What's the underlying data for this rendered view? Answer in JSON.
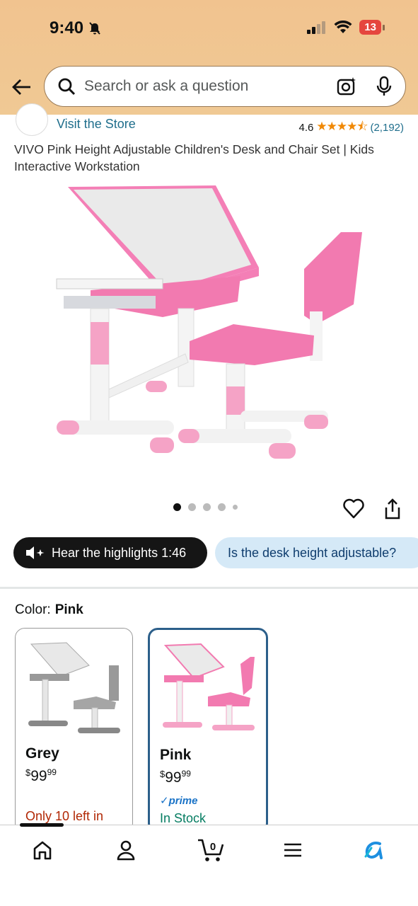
{
  "status_bar": {
    "time": "9:40",
    "battery": "13"
  },
  "search": {
    "placeholder": "Search or ask a question"
  },
  "store": {
    "visit_label": "Visit the Store",
    "rating": "4.6",
    "stars": "★★★★⯪",
    "rating_count": "(2,192)"
  },
  "product": {
    "title": "VIVO Pink Height Adjustable Children's Desk and Chair Set | Kids Interactive Workstation"
  },
  "gallery": {
    "active_index": 0,
    "dot_count": 5
  },
  "actions": {
    "hear_label": "Hear the highlights 1:46",
    "question_chip": "Is the desk height adjustable?"
  },
  "color": {
    "label": "Color:",
    "selected": "Pink",
    "options": [
      {
        "name": "Grey",
        "currency": "$",
        "price_whole": "99",
        "price_fraction": "99",
        "availability": "Only 10 left in",
        "prime": ""
      },
      {
        "name": "Pink",
        "currency": "$",
        "price_whole": "99",
        "price_fraction": "99",
        "availability": "In Stock",
        "prime": "prime"
      }
    ]
  },
  "colors": {
    "header_bg": "#f1c38f",
    "link": "#1f6e8c",
    "star": "#f08804",
    "in_stock": "#067d62",
    "low_stock": "#b12704",
    "selected_border": "#2c5f8a",
    "pink": "#f27ab0"
  },
  "nav": [
    "home-icon",
    "account-icon",
    "cart-icon",
    "menu-icon",
    "rufus-icon"
  ],
  "cart": {
    "count": "0"
  }
}
